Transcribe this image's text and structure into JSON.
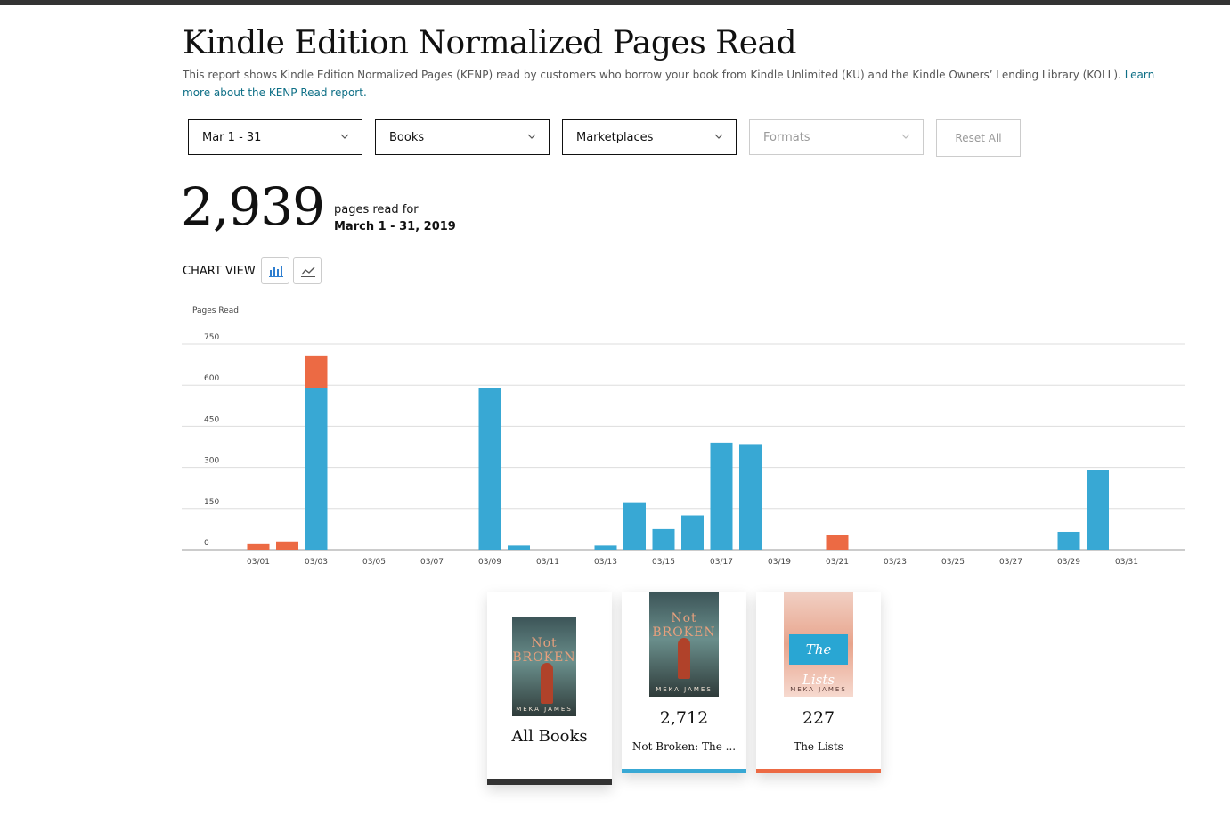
{
  "header": {
    "title": "Kindle Edition Normalized Pages Read",
    "description": "This report shows Kindle Edition Normalized Pages (KENP) read by customers who borrow your book from Kindle Unlimited (KU) and the Kindle Owners’ Lending Library (KOLL).",
    "learn_more": "Learn more about the KENP Read report."
  },
  "filters": {
    "date": "Mar 1 - 31",
    "books": "Books",
    "marketplaces": "Marketplaces",
    "formats": "Formats",
    "reset": "Reset All"
  },
  "summary": {
    "total": "2,939",
    "label": "pages read for",
    "period": "March 1 - 31, 2019"
  },
  "chart_view": {
    "label": "CHART VIEW",
    "options": [
      "bar-chart-icon",
      "line-chart-icon"
    ]
  },
  "colors": {
    "blue": "#38a8d4",
    "orange": "#ec6a44",
    "grid": "#dddddd"
  },
  "chart_data": {
    "type": "bar",
    "stacked": true,
    "ylabel": "Pages Read",
    "ylim": [
      0,
      750
    ],
    "yticks": [
      0,
      150,
      300,
      450,
      600,
      750
    ],
    "grid": true,
    "categories": [
      "03/01",
      "03/02",
      "03/03",
      "03/04",
      "03/05",
      "03/06",
      "03/07",
      "03/08",
      "03/09",
      "03/10",
      "03/11",
      "03/12",
      "03/13",
      "03/14",
      "03/15",
      "03/16",
      "03/17",
      "03/18",
      "03/19",
      "03/20",
      "03/21",
      "03/22",
      "03/23",
      "03/24",
      "03/25",
      "03/26",
      "03/27",
      "03/28",
      "03/29",
      "03/30",
      "03/31"
    ],
    "tick_labels": [
      "03/01",
      "03/03",
      "03/05",
      "03/07",
      "03/09",
      "03/11",
      "03/13",
      "03/15",
      "03/17",
      "03/19",
      "03/21",
      "03/23",
      "03/25",
      "03/27",
      "03/29",
      "03/31"
    ],
    "series": [
      {
        "color": "#38a8d4",
        "values": [
          0,
          0,
          590,
          0,
          0,
          0,
          0,
          0,
          590,
          15,
          0,
          0,
          15,
          170,
          75,
          125,
          390,
          385,
          0,
          0,
          0,
          0,
          0,
          0,
          0,
          0,
          0,
          0,
          65,
          290,
          0
        ]
      },
      {
        "color": "#ec6a44",
        "values": [
          20,
          30,
          115,
          0,
          0,
          0,
          0,
          0,
          0,
          0,
          0,
          0,
          0,
          0,
          0,
          0,
          0,
          0,
          0,
          0,
          55,
          0,
          0,
          0,
          0,
          0,
          0,
          0,
          0,
          0,
          0
        ]
      }
    ]
  },
  "books": [
    {
      "value": "",
      "name": "All Books",
      "cover_title": "Not BROKEN",
      "cover_author": "MEKA JAMES",
      "stripe": "#333333"
    },
    {
      "value": "2,712",
      "name": "Not Broken: The ...",
      "cover_title": "Not BROKEN",
      "cover_author": "MEKA JAMES",
      "stripe": "#38a8d4"
    },
    {
      "value": "227",
      "name": "The Lists",
      "cover_title": "The Lists",
      "cover_author": "MEKA JAMES",
      "stripe": "#ec6a44"
    }
  ]
}
